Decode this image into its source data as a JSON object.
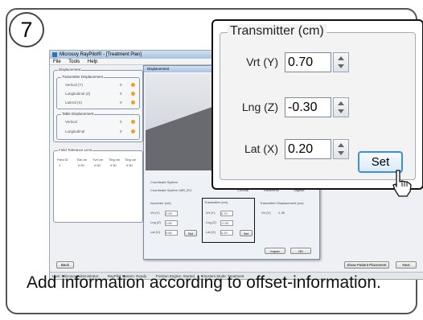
{
  "step": {
    "number": "7"
  },
  "app": {
    "title": "Microsoy RayPilot® - [Treatment Plan]",
    "menu": [
      "File",
      "Tools",
      "Help"
    ],
    "groups": {
      "displacement": "Displacement",
      "transmitter_disp": "Transmitter Displacement",
      "table_disp": "Table Displacement",
      "tolerance": "Field Tolerance Limit"
    },
    "rows": {
      "vertical": "Vertical (Y)",
      "longitudinal": "Longitudinal (Z)",
      "lateral": "Lateral (X)",
      "table_vertical": "Vertical",
      "table_longitudinal": "Longitudinal",
      "value_zero": "0",
      "unit": "(cm)"
    },
    "tolerance_headers": [
      "Field ID",
      "Tlat cm",
      "Tvrt cm",
      "Tlng cm",
      "Tlng cm"
    ],
    "tolerance_row": [
      "1",
      "0.50",
      "0.50",
      "0.50",
      "0.50"
    ],
    "back_button": "Back",
    "show_patient_button": "Show Patient Placement",
    "next_button": "Next",
    "status": {
      "user": "User: Microsoy Administrator",
      "system": "RayPilot System: Ready",
      "engine": "Position Engine: Started",
      "mode": "System Mode: Treatment"
    }
  },
  "dialog": {
    "title": "Displacement",
    "coord_label": "Coordinate System",
    "coord_value": "Coordinate System   VAR_IEC",
    "view_label": "View",
    "views": [
      "Coronal",
      "Transverse",
      "Sagittal"
    ],
    "isocenter_label": "Isocenter (cm)",
    "transmitter_label": "Transmitter (cm)",
    "disp_label": "Transmitter Displacement (cm)",
    "small_fields": [
      {
        "name": "Vrt (Y)",
        "iso": "2.00",
        "tx": "0.70",
        "disp": "-1.30"
      },
      {
        "name": "Lng (Z)",
        "iso": "1.50",
        "tx": "-0.30"
      },
      {
        "name": "Lat (X)",
        "iso": "0.60",
        "tx": "0.20"
      }
    ],
    "set": "Set",
    "import": "Import",
    "ok": "OK"
  },
  "transmitter": {
    "title": "Transmitter (cm)",
    "fields": [
      {
        "label": "Vrt (Y)",
        "value": "0.70"
      },
      {
        "label": "Lng (Z)",
        "value": "-0.30"
      },
      {
        "label": "Lat (X)",
        "value": "0.20"
      }
    ],
    "set_label": "Set"
  },
  "caption": "Add information according to offset-information."
}
